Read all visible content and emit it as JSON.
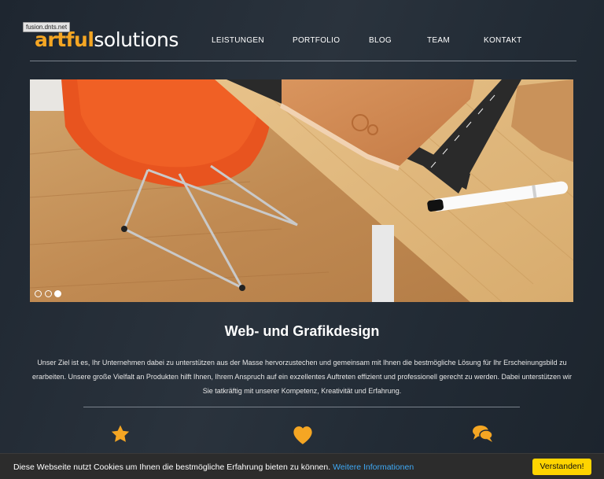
{
  "browser": {
    "site_badge": "fusion.dnts.net"
  },
  "logo": {
    "part1": "artful",
    "part2": "solutions"
  },
  "nav": {
    "items": [
      {
        "label": "LEISTUNGEN"
      },
      {
        "label": "PORTFOLIO"
      },
      {
        "label": "BLOG"
      },
      {
        "label": "TEAM"
      },
      {
        "label": "KONTAKT"
      }
    ]
  },
  "slider": {
    "slide_count": 3,
    "active_slide": 3
  },
  "main": {
    "heading": "Web- und Grafikdesign",
    "intro": "Unser Ziel ist es, Ihr Unternehmen dabei zu unterstützen aus der Masse hervorzustechen und gemeinsam mit Ihnen die bestmögliche Lösung für Ihr Erscheinungsbild zu erarbeiten.  Unsere große Vielfalt an Produkten hilft Ihnen, Ihrem Anspruch auf ein exzellentes Auftreten effizient und professionell gerecht zu werden.  Dabei unterstützen wir Sie tatkräftig mit unserer Kompetenz, Kreativität und Erfahrung."
  },
  "features": {
    "icons": [
      "star-icon",
      "heart-icon",
      "chat-bubbles-icon"
    ]
  },
  "cookie": {
    "message": "Diese Webseite nutzt Cookies um Ihnen die bestmögliche Erfahrung bieten zu können.",
    "link_label": "Weitere Informationen",
    "button_label": "Verstanden!"
  },
  "colors": {
    "accent": "#f5a623",
    "background": "#232c36",
    "cookie_button": "#ffd400",
    "cookie_link": "#3fa9f5"
  }
}
